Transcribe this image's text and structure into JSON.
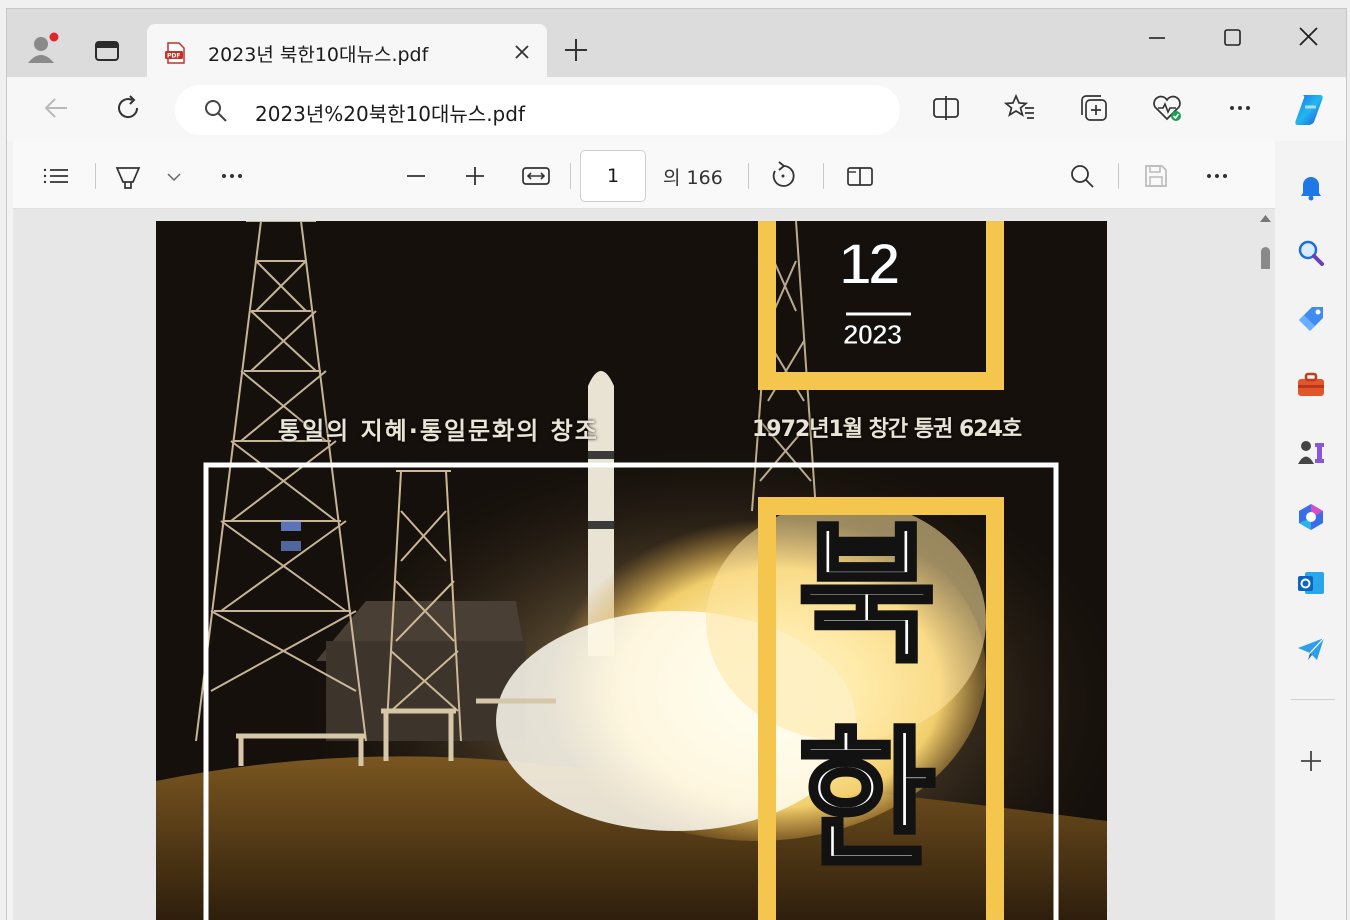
{
  "browser": {
    "tab": {
      "title": "2023년 북한10대뉴스.pdf"
    },
    "address": {
      "url": "2023년%20북한10대뉴스.pdf"
    },
    "icons": [
      "profile-icon",
      "tab-actions-icon",
      "pdf-icon",
      "close-icon",
      "new-tab-icon",
      "minimize-icon",
      "maximize-icon",
      "close-window-icon",
      "back-icon",
      "refresh-icon",
      "search-icon",
      "split-screen-icon",
      "favorites-icon",
      "collections-icon",
      "browser-essentials-icon",
      "more-icon",
      "copilot-icon"
    ]
  },
  "pdf_toolbar": {
    "page_current": "1",
    "page_total": "의 166",
    "icons": [
      "contents-icon",
      "draw-icon",
      "chevron-down-icon",
      "more-icon",
      "zoom-out-icon",
      "zoom-in-icon",
      "fit-width-icon",
      "rotate-icon",
      "page-view-icon",
      "search-icon",
      "save-icon",
      "more-icon"
    ]
  },
  "sidebar": {
    "icons": [
      "notifications-icon",
      "search-icon",
      "shopping-icon",
      "tools-icon",
      "games-icon",
      "microsoft-365-icon",
      "outlook-icon",
      "telegram-icon",
      "add-icon"
    ]
  },
  "document": {
    "month": "12",
    "year": "2023",
    "slogan": "통일의 지혜·통일문화의 창조",
    "issue": "1972년1월 창간 통권 624호",
    "title_chars": [
      "북",
      "한"
    ],
    "accent_color": "#f4c64e"
  }
}
